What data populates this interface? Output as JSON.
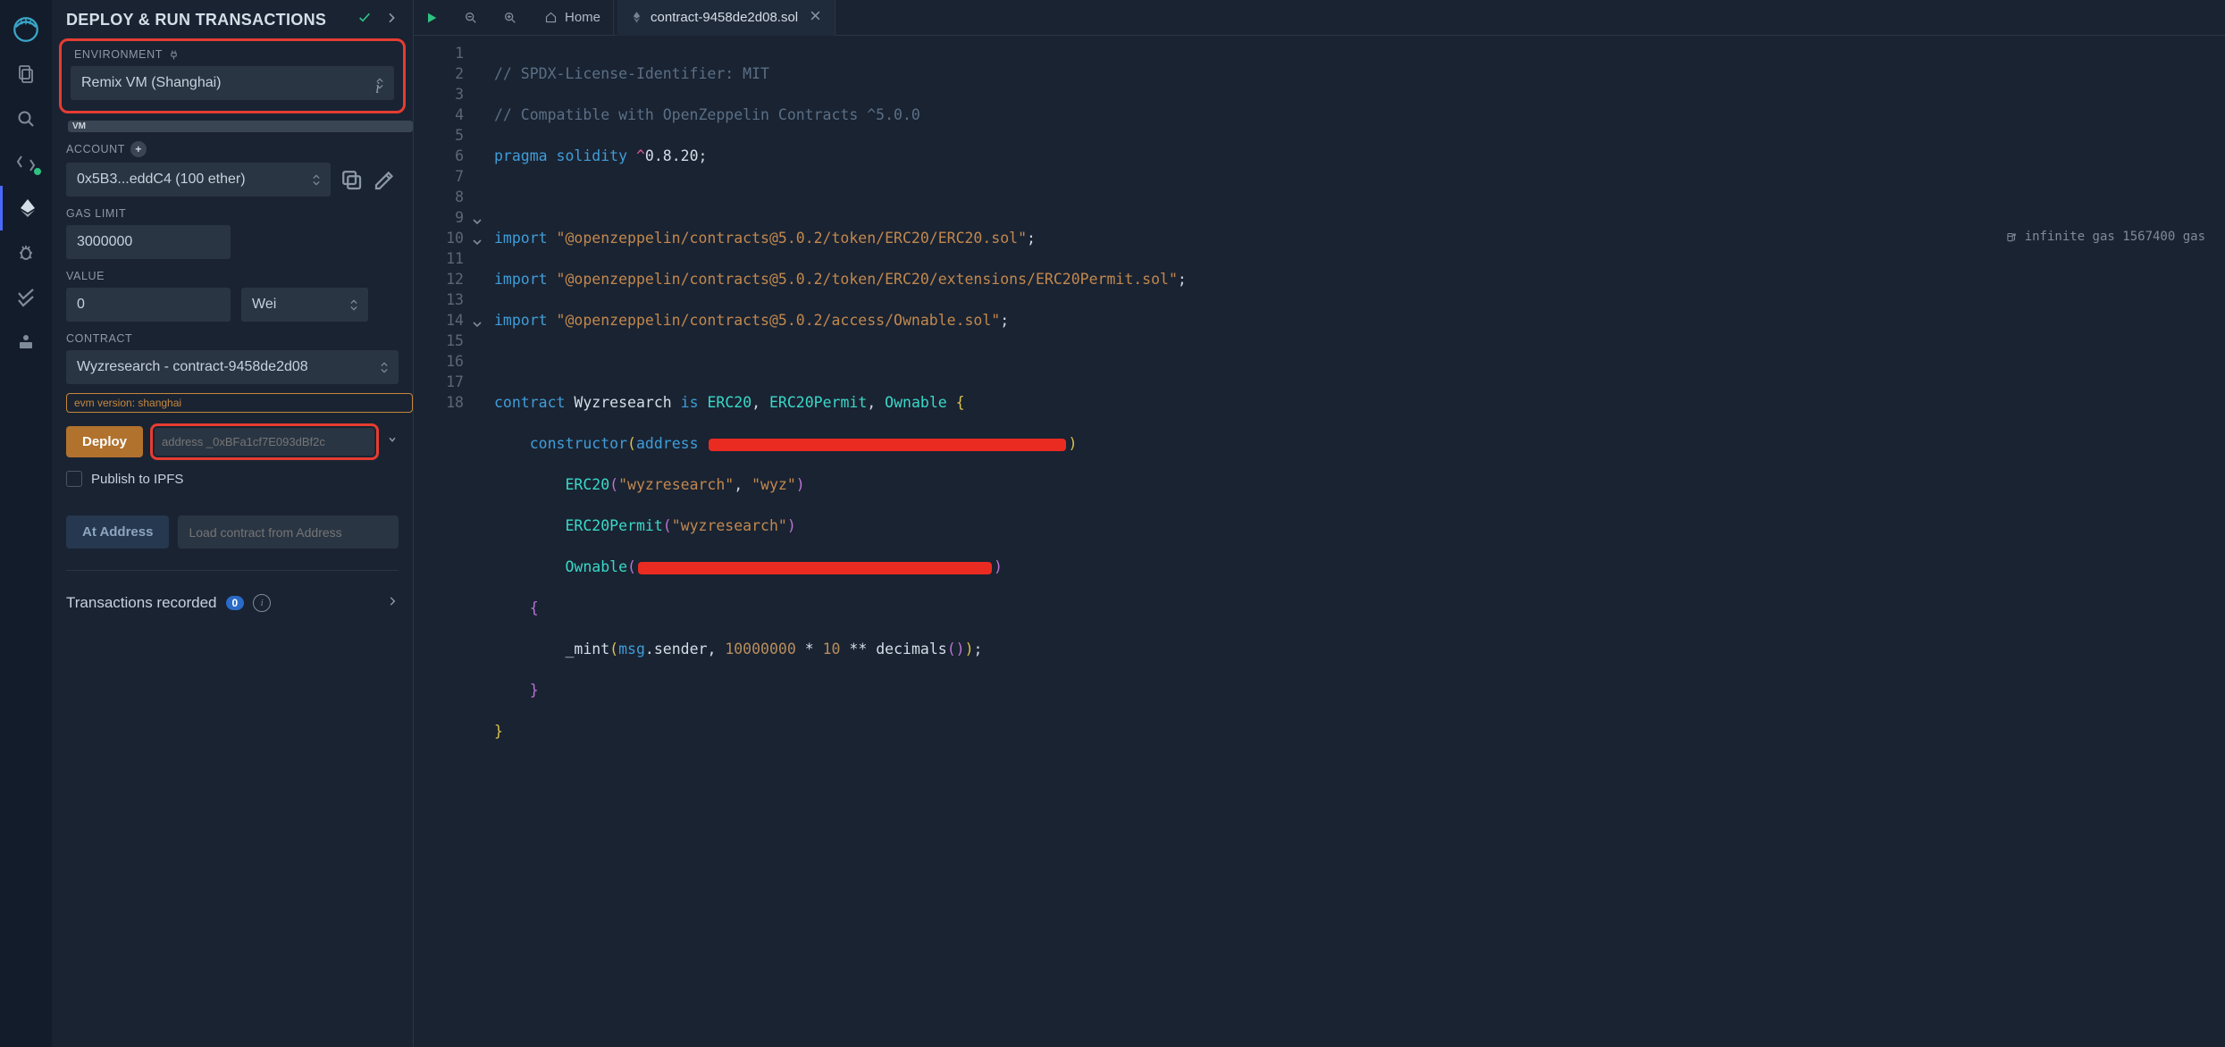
{
  "panel": {
    "title": "DEPLOY & RUN TRANSACTIONS",
    "env_label": "ENVIRONMENT",
    "env_value": "Remix VM (Shanghai)",
    "vm_tag": "VM",
    "account_label": "ACCOUNT",
    "account_value": "0x5B3...eddC4 (100 ether)",
    "gas_label": "GAS LIMIT",
    "gas_value": "3000000",
    "value_label": "VALUE",
    "value_amount": "0",
    "value_unit": "Wei",
    "contract_label": "CONTRACT",
    "contract_value": "Wyzresearch - contract-9458de2d08",
    "evm_badge": "evm version: shanghai",
    "deploy_label": "Deploy",
    "deploy_placeholder": "address _0xBFa1cf7E093dBf2c",
    "publish_label": "Publish to IPFS",
    "ataddress_label": "At Address",
    "ataddress_placeholder": "Load contract from Address",
    "tx_recorded": "Transactions recorded",
    "tx_count": "0"
  },
  "tabs": {
    "home": "Home",
    "file": "contract-9458de2d08.sol"
  },
  "gas_note": "infinite gas 1567400 gas",
  "code": {
    "l1": "// SPDX-License-Identifier: MIT",
    "l2": "// Compatible with OpenZeppelin Contracts ^5.0.0",
    "l3_a": "pragma",
    "l3_b": "solidity",
    "l3_c": "^0.8.20;",
    "l5_a": "import",
    "l5_b": "\"@openzeppelin/contracts@5.0.2/token/ERC20/ERC20.sol\"",
    "l6_a": "import",
    "l6_b": "\"@openzeppelin/contracts@5.0.2/token/ERC20/extensions/ERC20Permit.sol\"",
    "l7_a": "import",
    "l7_b": "\"@openzeppelin/contracts@5.0.2/access/Ownable.sol\"",
    "l9_a": "contract",
    "l9_b": "Wyzresearch",
    "l9_c": "is",
    "l9_d": "ERC20",
    "l9_e": "ERC20Permit",
    "l9_f": "Ownable",
    "l10_a": "constructor",
    "l10_b": "address",
    "l11_a": "ERC20",
    "l11_b": "\"wyzresearch\"",
    "l11_c": "\"wyz\"",
    "l12_a": "ERC20Permit",
    "l12_b": "\"wyzresearch\"",
    "l13_a": "Ownable",
    "l15_a": "_mint",
    "l15_b": "msg",
    "l15_c": ".sender, ",
    "l15_d": "10000000",
    "l15_e": " * ",
    "l15_f": "10",
    "l15_g": " ** decimals",
    "l15_h": "()"
  }
}
